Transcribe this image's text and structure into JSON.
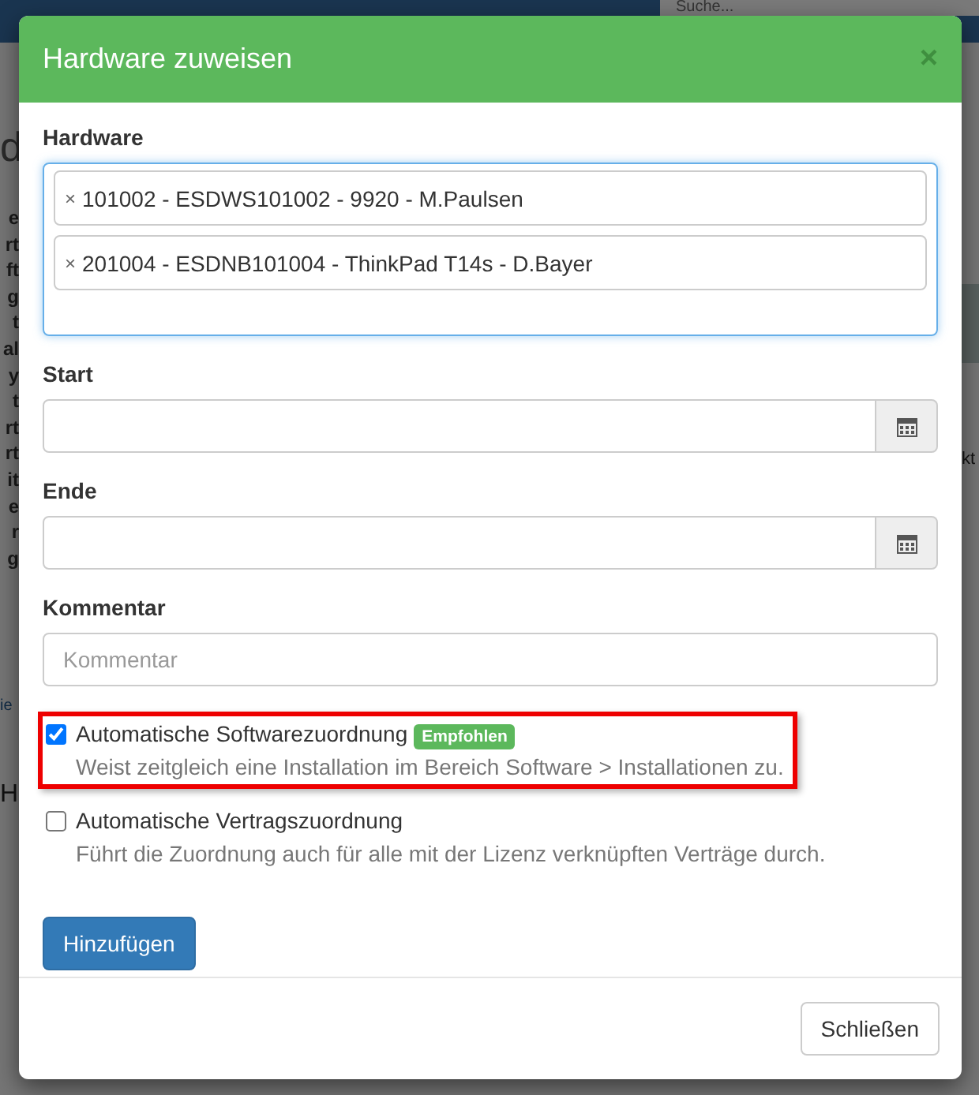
{
  "background": {
    "search_placeholder": "Suche...",
    "heading_fragment": "d",
    "row_fragments": [
      "e",
      "rt",
      "ft",
      "g",
      "t",
      "al",
      "y",
      "t",
      "rt",
      "rt",
      "it",
      "e",
      "r",
      "g"
    ],
    "link_fragment": "ie",
    "section_fragment": "H",
    "tab_fragment": "kt"
  },
  "modal": {
    "title": "Hardware zuweisen",
    "close": "×",
    "fields": [
      {
        "kind": "tags",
        "label": "Hardware",
        "tags": [
          {
            "remove": "×",
            "text": "101002 - ESDWS101002 - 9920 - M.Paulsen"
          },
          {
            "remove": "×",
            "text": "201004 - ESDNB101004 - ThinkPad T14s - D.Bayer"
          }
        ]
      },
      {
        "kind": "date",
        "label": "Start"
      },
      {
        "kind": "date",
        "label": "Ende"
      },
      {
        "kind": "text",
        "label": "Kommentar",
        "placeholder": "Kommentar"
      }
    ],
    "options": [
      {
        "label": "Automatische Softwarezuordnung",
        "badge": "Empfohlen",
        "description": "Weist zeitgleich eine Installation im Bereich Software > Installationen zu.",
        "checked": true,
        "highlighted": true
      },
      {
        "label": "Automatische Vertragszuordnung",
        "description": "Führt die Zuordnung auch für alle mit der Lizenz verknüpften Verträge durch.",
        "checked": false,
        "highlighted": false
      }
    ],
    "submit": "Hinzufügen",
    "close_button": "Schließen"
  }
}
